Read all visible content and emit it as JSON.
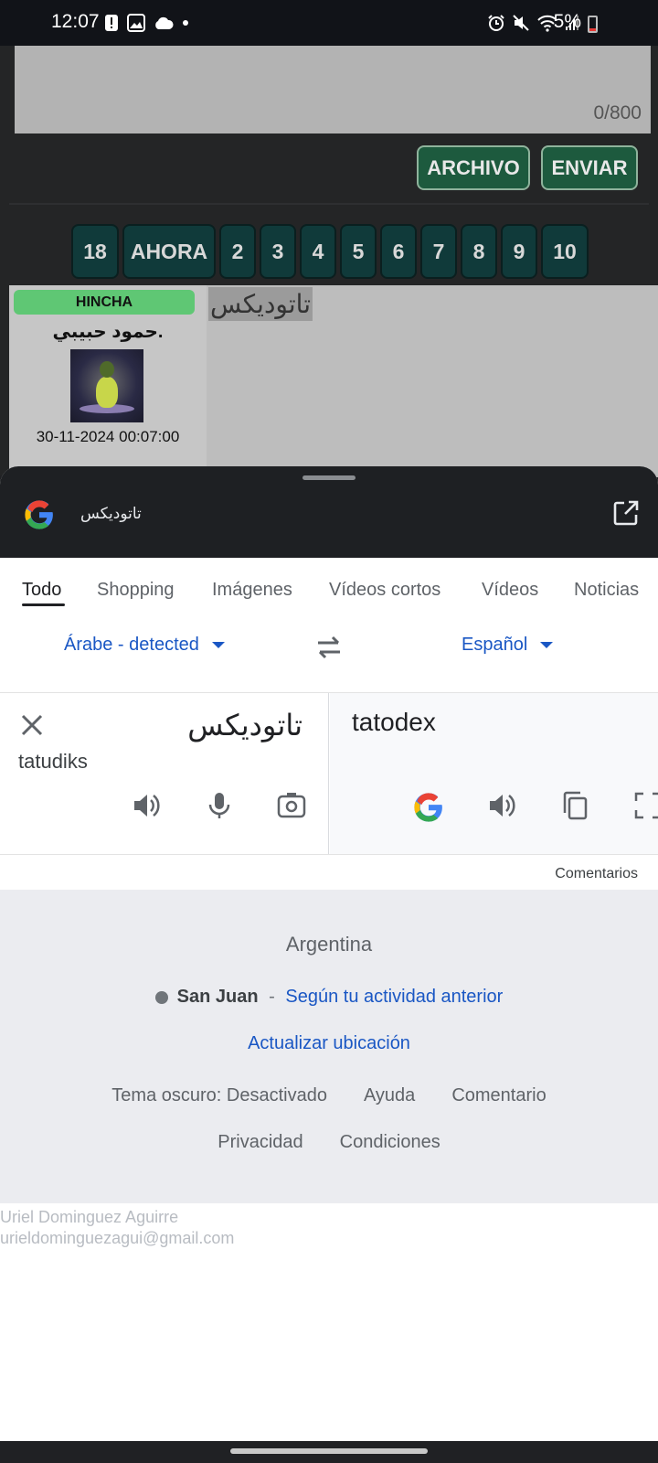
{
  "status_bar": {
    "time": "12:07",
    "battery": "5%",
    "left_icons": [
      "alert-icon",
      "image-icon",
      "cloud-icon",
      "dot-icon"
    ],
    "right_icons": [
      "alarm-icon",
      "mute-icon",
      "wifi-icon",
      "signal-icon",
      "battery-icon"
    ]
  },
  "forum": {
    "counter": "0/800",
    "buttons": {
      "file": "ARCHIVO",
      "send": "ENVIAR"
    },
    "pages": [
      "18",
      "AHORA",
      "2",
      "3",
      "4",
      "5",
      "6",
      "7",
      "8",
      "9",
      "10"
    ],
    "post": {
      "rank": "HINCHA",
      "username": "حمود حبيبي.",
      "date": "30-11-2024 00:07:00",
      "text": "تاتوديكس"
    }
  },
  "sheet": {
    "query": "تاتوديكس",
    "tabs": [
      "Todo",
      "Shopping",
      "Imágenes",
      "Vídeos cortos",
      "Vídeos",
      "Noticias"
    ],
    "active_tab": "Todo",
    "source_lang": "Árabe - detected",
    "target_lang": "Español",
    "source_text": "تاتوديكس",
    "transliteration": "tatudiks",
    "translation": "tatodex",
    "comments": "Comentarios",
    "footer": {
      "country": "Argentina",
      "city": "San Juan",
      "separator": " - ",
      "location_source": "Según tu actividad anterior",
      "update_location": "Actualizar ubicación",
      "links_row1": [
        "Tema oscuro: Desactivado",
        "Ayuda",
        "Comentario"
      ],
      "links_row2": [
        "Privacidad",
        "Condiciones"
      ]
    },
    "account": {
      "name": "Uriel Dominguez Aguirre",
      "email": "urieldominguezagui@gmail.com"
    }
  },
  "colors": {
    "link_blue": "#1a57c4",
    "forum_button_green": "#1d5a3e",
    "rank_green": "#5fc774",
    "page_button_teal": "#103a3a"
  }
}
